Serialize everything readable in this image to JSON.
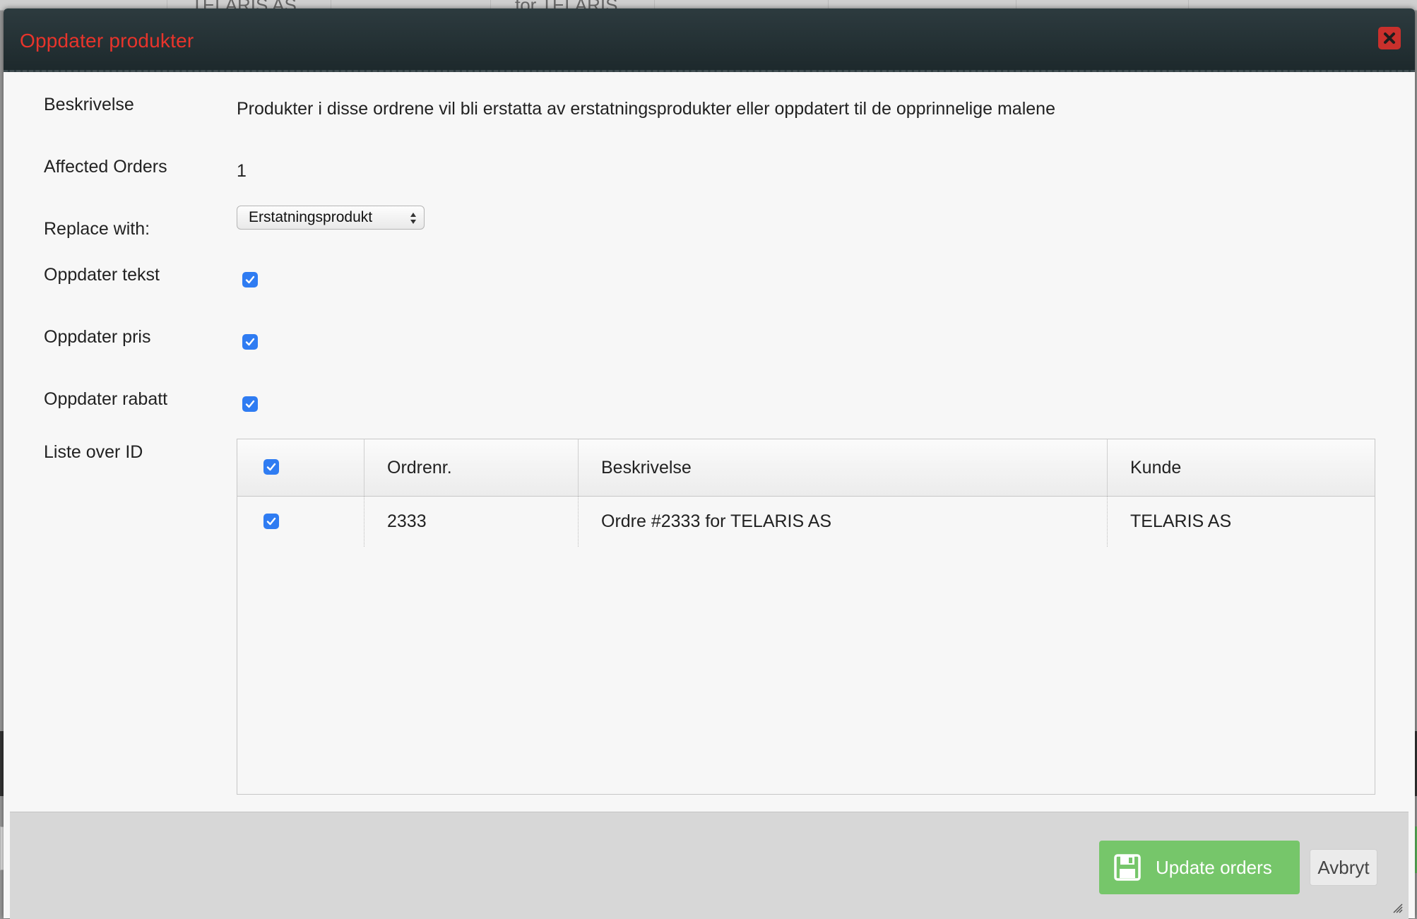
{
  "background": {
    "cells": [
      "TELARIS AS",
      "for TELARIS"
    ]
  },
  "dialog": {
    "title": "Oppdater produkter",
    "close_icon": "close-icon",
    "fields": {
      "description_label": "Beskrivelse",
      "description_value": "Produkter i disse ordrene vil bli erstatta av erstatningsprodukter eller oppdatert til de opprinnelige malene",
      "affected_label": "Affected Orders",
      "affected_value": "1",
      "replace_label": "Replace with:",
      "replace_selected": "Erstatningsprodukt",
      "update_text_label": "Oppdater tekst",
      "update_text_checked": true,
      "update_price_label": "Oppdater pris",
      "update_price_checked": true,
      "update_discount_label": "Oppdater rabatt",
      "update_discount_checked": true,
      "id_list_label": "Liste over ID"
    },
    "grid": {
      "columns": [
        "",
        "Ordrenr.",
        "Beskrivelse",
        "Kunde"
      ],
      "select_all_checked": true,
      "rows": [
        {
          "checked": true,
          "order_no": "2333",
          "description": "Ordre #2333 for TELARIS AS",
          "customer": "TELARIS AS"
        }
      ]
    },
    "footer": {
      "update_label": "Update orders",
      "cancel_label": "Avbryt"
    },
    "colors": {
      "title": "#e8342b",
      "titlebar": "#1d292c",
      "close_button": "#c9302c",
      "checkbox": "#2f7cf2",
      "update_button": "#76c66a"
    }
  }
}
